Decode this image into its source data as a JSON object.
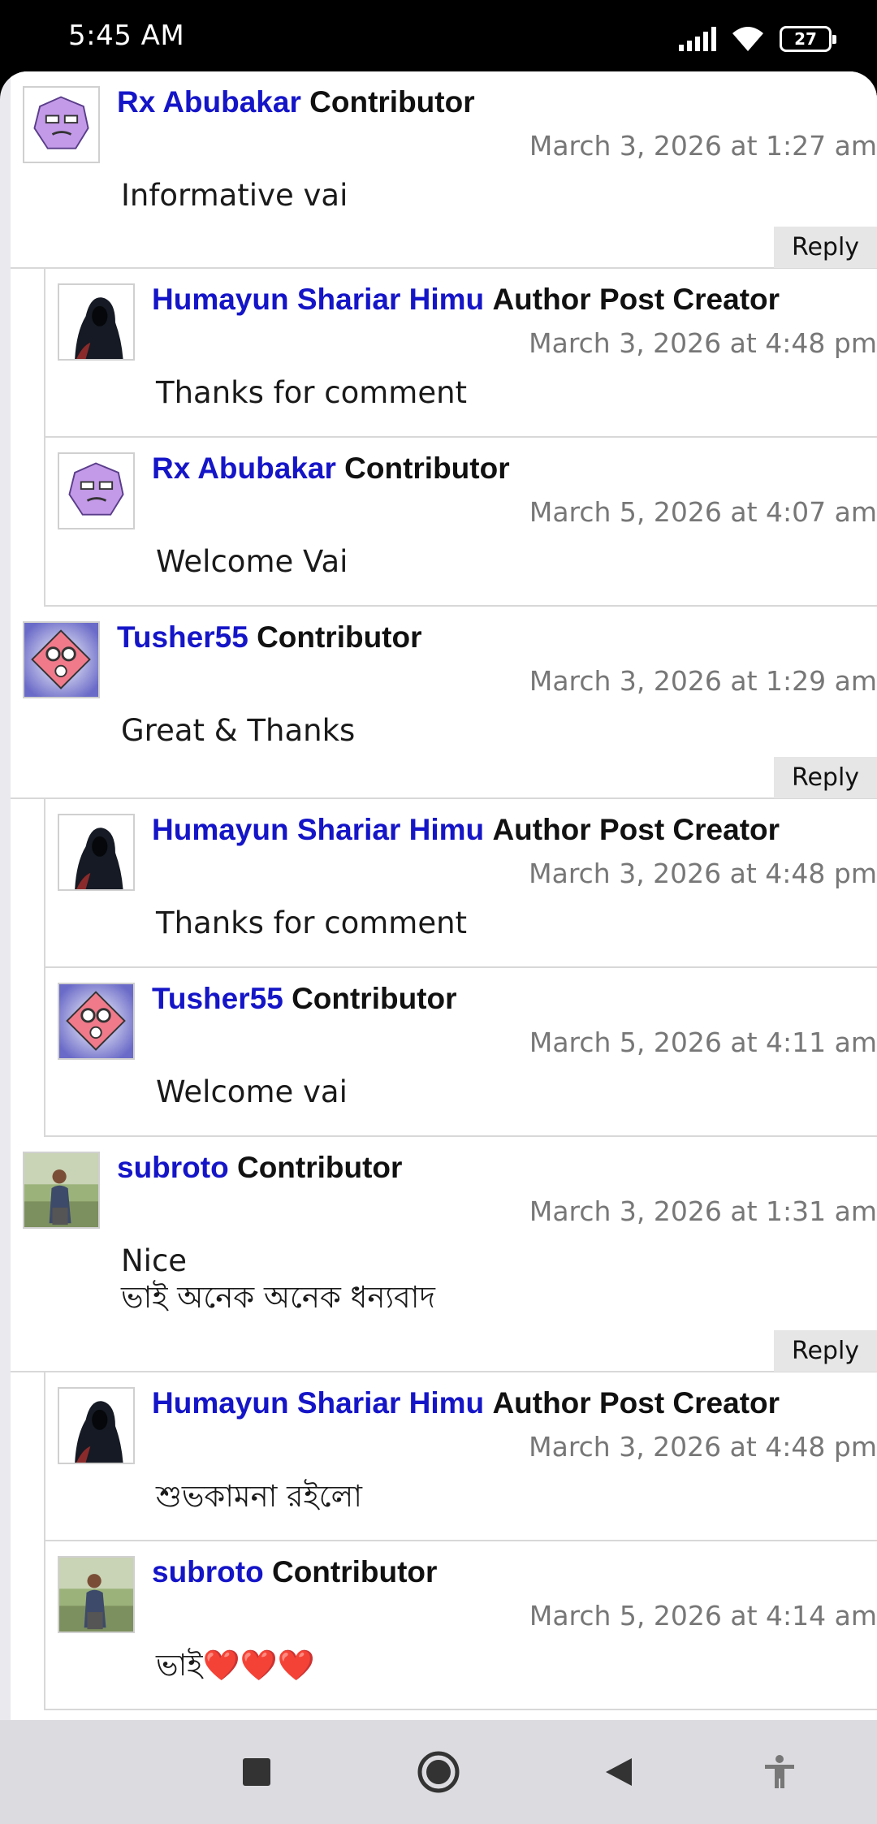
{
  "status_bar": {
    "time": "5:45 AM",
    "battery": "27",
    "icons": [
      "signal-icon",
      "wifi-icon",
      "battery-icon"
    ]
  },
  "reply_label": "Reply",
  "comments": [
    {
      "author": "Rx Abubakar",
      "role": "Contributor",
      "date": "March 3, 2026 at 1:27 am",
      "text": "Informative vai",
      "avatar": "purple-face-avatar"
    },
    {
      "author": "Humayun Shariar Himu",
      "role": "Author Post Creator",
      "date": "March 3, 2026 at 4:48 pm",
      "text": "Thanks for comment",
      "avatar": "hooded-figure-avatar"
    },
    {
      "author": "Rx Abubakar",
      "role": "Contributor",
      "date": "March 5, 2026 at 4:07 am",
      "text": "Welcome Vai",
      "avatar": "purple-face-avatar"
    },
    {
      "author": "Tusher55",
      "role": "Contributor",
      "date": "March 3, 2026 at 1:29 am",
      "text": "Great & Thanks",
      "avatar": "diamond-face-avatar"
    },
    {
      "author": "Humayun Shariar Himu",
      "role": "Author Post Creator",
      "date": "March 3, 2026 at 4:48 pm",
      "text": "Thanks for comment",
      "avatar": "hooded-figure-avatar"
    },
    {
      "author": "Tusher55",
      "role": "Contributor",
      "date": "March 5, 2026 at 4:11 am",
      "text": "Welcome vai",
      "avatar": "diamond-face-avatar"
    },
    {
      "author": "subroto",
      "role": "Contributor",
      "date": "March 3, 2026 at 1:31 am",
      "text": "Nice\nভাই অনেক অনেক ধন্যবাদ",
      "avatar": "photo-avatar"
    },
    {
      "author": "Humayun Shariar Himu",
      "role": "Author Post Creator",
      "date": "March 3, 2026 at 4:48 pm",
      "text": "শুভকামনা রইলো",
      "avatar": "hooded-figure-avatar"
    },
    {
      "author": "subroto",
      "role": "Contributor",
      "date": "March 5, 2026 at 4:14 am",
      "text": "ভাই❤️❤️❤️",
      "avatar": "photo-avatar"
    }
  ],
  "nav_bar": {
    "buttons": [
      "recents-button",
      "home-button",
      "back-button",
      "accessibility-button"
    ]
  },
  "colors": {
    "author_link": "#1515c8",
    "date_text": "#777777",
    "reply_bg": "#e6e6e6",
    "nav_bg": "#dcdce0"
  }
}
